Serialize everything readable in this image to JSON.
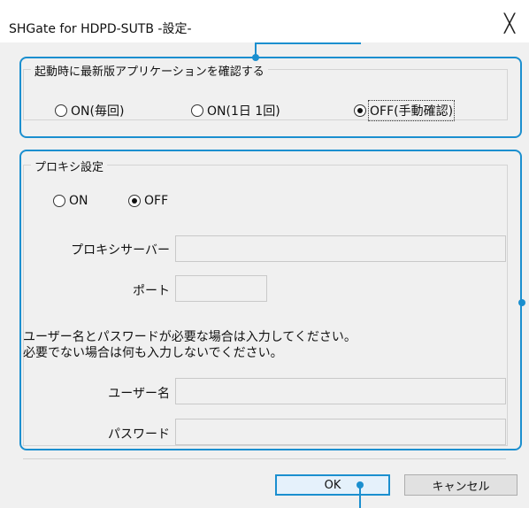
{
  "window": {
    "title": "SHGate for HDPD-SUTB -設定-",
    "close_glyph": "╳"
  },
  "update_check": {
    "caption": "起動時に最新版アプリケーションを確認する",
    "options": [
      {
        "label": "ON(毎回)",
        "checked": false
      },
      {
        "label": "ON(1日 1回)",
        "checked": false
      },
      {
        "label": "OFF(手動確認)",
        "checked": true
      }
    ]
  },
  "proxy": {
    "caption": "プロキシ設定",
    "mode_options": [
      {
        "label": "ON",
        "checked": false
      },
      {
        "label": "OFF",
        "checked": true
      }
    ],
    "server_label": "プロキシサーバー",
    "server_value": "",
    "port_label": "ポート",
    "port_value": "",
    "note_line1": "ユーザー名とパスワードが必要な場合は入力してください。",
    "note_line2": "必要でない場合は何も入力しないでください。",
    "username_label": "ユーザー名",
    "username_value": "",
    "password_label": "パスワード",
    "password_value": ""
  },
  "buttons": {
    "ok": "OK",
    "cancel": "キャンセル"
  },
  "colors": {
    "callout": "#1b8fcf",
    "dialog_bg": "#f0f0f0"
  }
}
